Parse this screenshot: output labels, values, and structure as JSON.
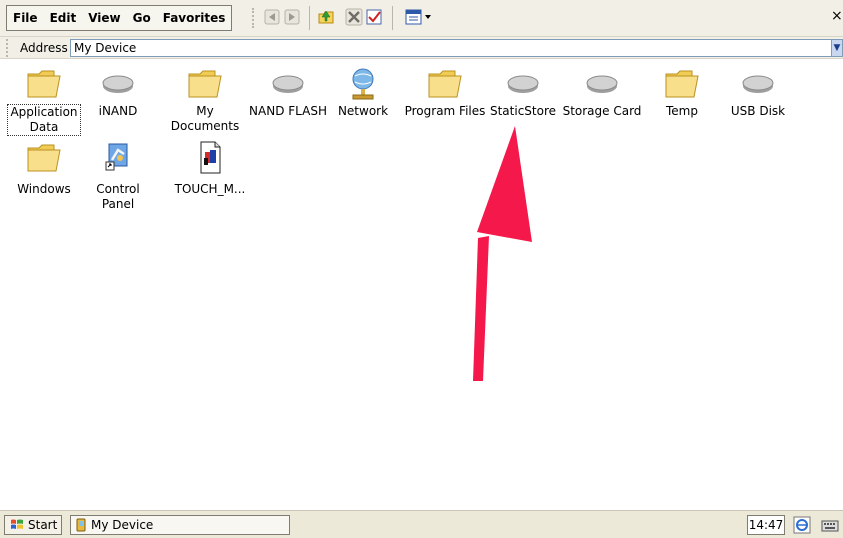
{
  "menubar": {
    "items": [
      "File",
      "Edit",
      "View",
      "Go",
      "Favorites"
    ],
    "close_glyph": "×"
  },
  "address": {
    "label": "Address",
    "value": "My Device"
  },
  "files": [
    {
      "label1": "Application",
      "label2": "Data",
      "icon": "folder-icon",
      "selected": true
    },
    {
      "label1": "iNAND",
      "label2": "",
      "icon": "drive-icon"
    },
    {
      "label1": "My",
      "label2": "Documents",
      "icon": "folder-icon"
    },
    {
      "label1": "NAND FLASH",
      "label2": "",
      "icon": "drive-icon"
    },
    {
      "label1": "Network",
      "label2": "",
      "icon": "network-icon"
    },
    {
      "label1": "Program Files",
      "label2": "",
      "icon": "folder-icon"
    },
    {
      "label1": "StaticStore",
      "label2": "",
      "icon": "drive-icon"
    },
    {
      "label1": "Storage Card",
      "label2": "",
      "icon": "drive-icon"
    },
    {
      "label1": "Temp",
      "label2": "",
      "icon": "folder-icon"
    },
    {
      "label1": "USB Disk",
      "label2": "",
      "icon": "drive-icon"
    },
    {
      "label1": "Windows",
      "label2": "",
      "icon": "folder-icon"
    },
    {
      "label1": "Control",
      "label2": "Panel",
      "icon": "control-panel-icon"
    },
    {
      "label1": "TOUCH_M...",
      "label2": "",
      "icon": "document-icon"
    }
  ],
  "taskbar": {
    "start_label": "Start",
    "task_label": "My Device",
    "clock": "14:47"
  }
}
